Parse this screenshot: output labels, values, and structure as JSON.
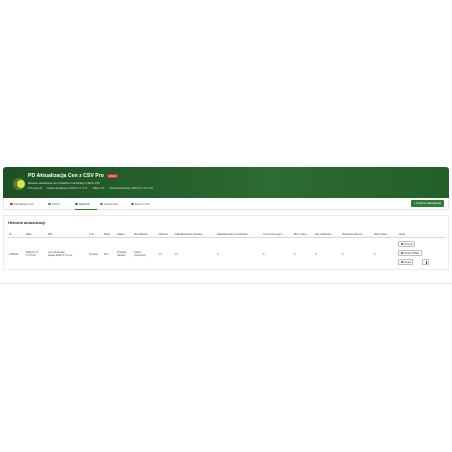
{
  "header": {
    "title": "PD Aktualizacja Cen z CSV Pro",
    "badge": "v2.0.0",
    "subtitle": "Masowe aktualizacje cen produktów i kombinacji z plików CSV",
    "meta": [
      "5 Pre-pliuuuw",
      "Ostatnia aktualizacja: 2025-07-17 17:17",
      "2 Błędy: 0/0",
      "Ostatnia aktualizacja: 2025-07-17 17:17:00"
    ],
    "links": [
      "Dokumentacja",
      "Wsparcie"
    ]
  },
  "tabs": {
    "items": [
      "Aktualizacja cen",
      "Klienci",
      "Historia",
      "Ustawienia",
      "Pomoc CSV"
    ],
    "active": "Historia",
    "new_button": "+ Uruchom aktualizację"
  },
  "history": {
    "title": "Historia aktualizacji",
    "columns": [
      "ID",
      "Data",
      "Plik",
      "Tryb",
      "Sklep",
      "Zakres",
      "Identyfikator",
      "Wiersze",
      "Zaktualizowane produkty",
      "Zaktualizowane kombinacje",
      "Ceny promocyjne",
      "Bez zmiany",
      "Nie znaleziono",
      "Pominięte wiersze",
      "Zatrzymane",
      "Akcje"
    ],
    "row": {
      "id": "1098414",
      "date": [
        "2025-07-17",
        "17:17:00"
      ],
      "file": [
        "ceny-wholesale-",
        "aspekt-2025-07-17.csv"
      ],
      "mode": "Hurtowe",
      "shop": "SKY",
      "range": [
        "Produkty",
        "bazowe"
      ],
      "identifier": [
        "Indeks",
        "(reference)"
      ],
      "rows": "23",
      "updated_products": "23",
      "updated_combinations": "0",
      "promo_prices": "0",
      "no_change": "0",
      "not_found": "0",
      "skipped_rows": "0",
      "stopped": "0"
    },
    "actions": {
      "preview": "Przejrzyj",
      "download": "Pobierz ID/Wrt",
      "repeat": "Ponów"
    }
  }
}
